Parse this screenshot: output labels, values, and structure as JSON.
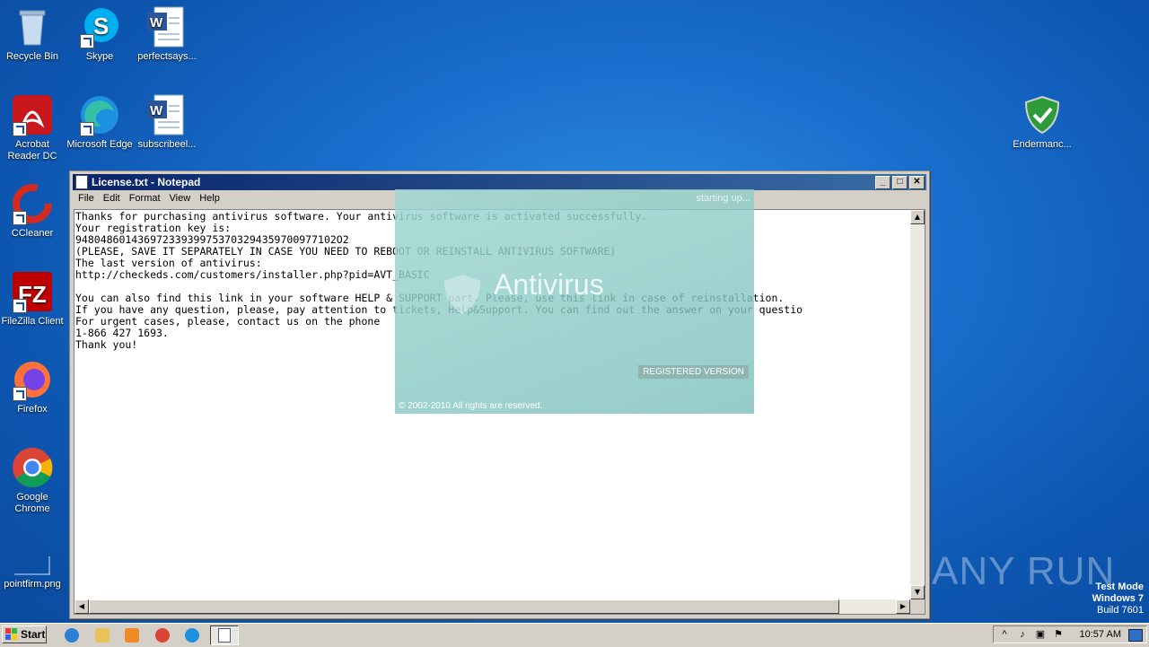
{
  "desktop": {
    "icons": [
      {
        "label": "Recycle Bin"
      },
      {
        "label": "Skype"
      },
      {
        "label": "perfectsays..."
      },
      {
        "label": "Acrobat Reader DC"
      },
      {
        "label": "Microsoft Edge"
      },
      {
        "label": "subscribeel..."
      },
      {
        "label": "CCleaner"
      },
      {
        "label": "FileZilla Client"
      },
      {
        "label": "Firefox"
      },
      {
        "label": "Google Chrome"
      },
      {
        "label": "pointfirm.png"
      },
      {
        "label": "Endermanc..."
      }
    ]
  },
  "notepad": {
    "title": "License.txt - Notepad",
    "menu": [
      "File",
      "Edit",
      "Format",
      "View",
      "Help"
    ],
    "content": "Thanks for purchasing antivirus software. Your antivirus software is activated successfully.\nYour registration key is:\n948048601436972339399753703294359700977102O2\n(PLEASE, SAVE IT SEPARATELY IN CASE YOU NEED TO REBOOT OR REINSTALL ANTIVIRUS SOFTWARE)\nThe last version of antivirus:\nhttp://checkeds.com/customers/installer.php?pid=AVT_BASIC\n\nYou can also find this link in your software HELP & SUPPORT part. Please, use this link in case of reinstallation.\nIf you have any question, please, pay attention to tickets, Help&Support. You can find out the answer on your questio\nFor urgent cases, please, contact us on the phone\n1-866 427 1693.\nThank you!\n"
  },
  "splash": {
    "status": "starting up...",
    "brand": "Antivirus",
    "badge": "REGISTERED VERSION",
    "copyright": "© 2002-2010 All rights are reserved."
  },
  "watermark": "ANY RUN",
  "testmode": {
    "line1": "Test Mode",
    "line2": "Windows 7",
    "line3": "Build 7601"
  },
  "taskbar": {
    "start_label": "Start",
    "clock": "10:57 AM"
  }
}
